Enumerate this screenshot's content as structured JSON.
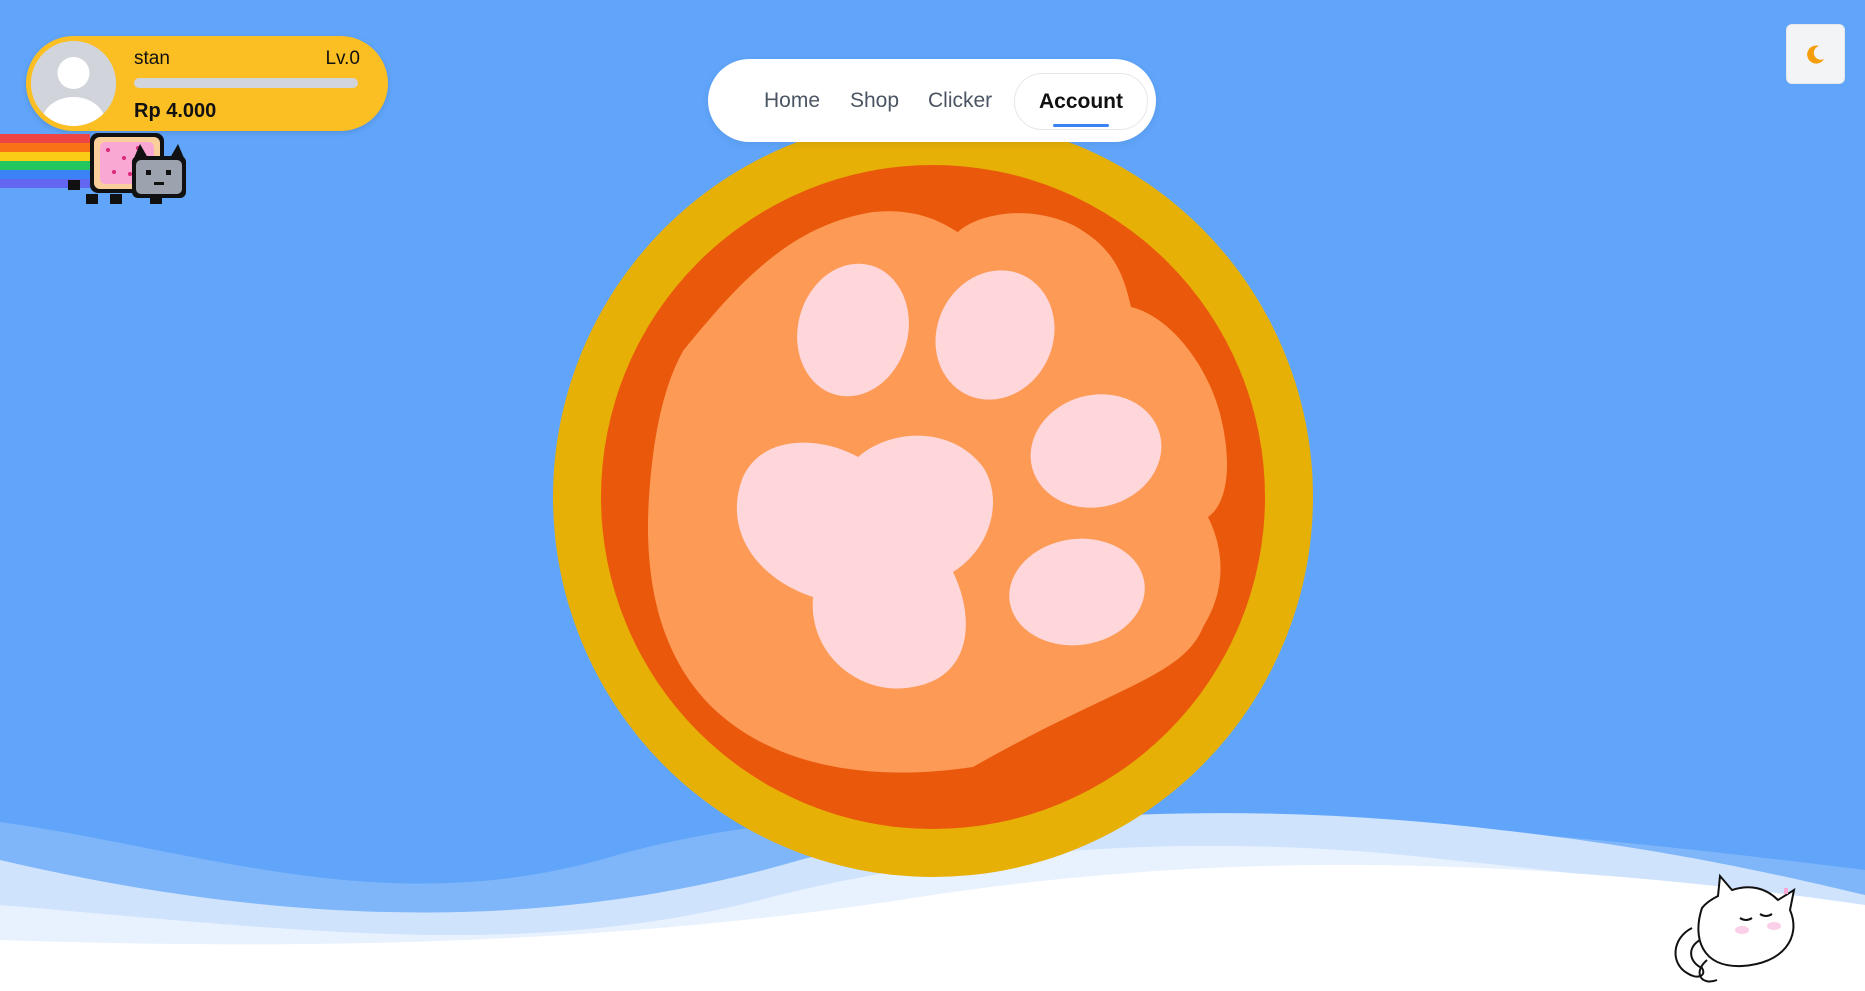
{
  "profile": {
    "username": "stan",
    "level": "Lv.0",
    "xp_progress": 0.0,
    "money": "Rp 4.000",
    "avatar_icon": "user-avatar-icon",
    "card_color": "#fbbf24"
  },
  "nav": {
    "items": [
      {
        "label": "Home"
      },
      {
        "label": "Shop"
      },
      {
        "label": "Clicker"
      },
      {
        "label": "Account"
      }
    ],
    "active": "Account",
    "accent": "#3b82f6"
  },
  "theme_toggle": {
    "icon": "moon-icon"
  },
  "clicker": {
    "icon": "paw-icon",
    "colors": {
      "outer": "#e6b007",
      "ring": "#ea580c",
      "pad": "#fd9a55",
      "toes": "#ffd6d9"
    }
  },
  "background": {
    "sky": "#60a5fa"
  },
  "decorations": {
    "nyan_cat": "nyan-cat-icon",
    "sleeping_cat": "sleeping-cat-icon"
  }
}
